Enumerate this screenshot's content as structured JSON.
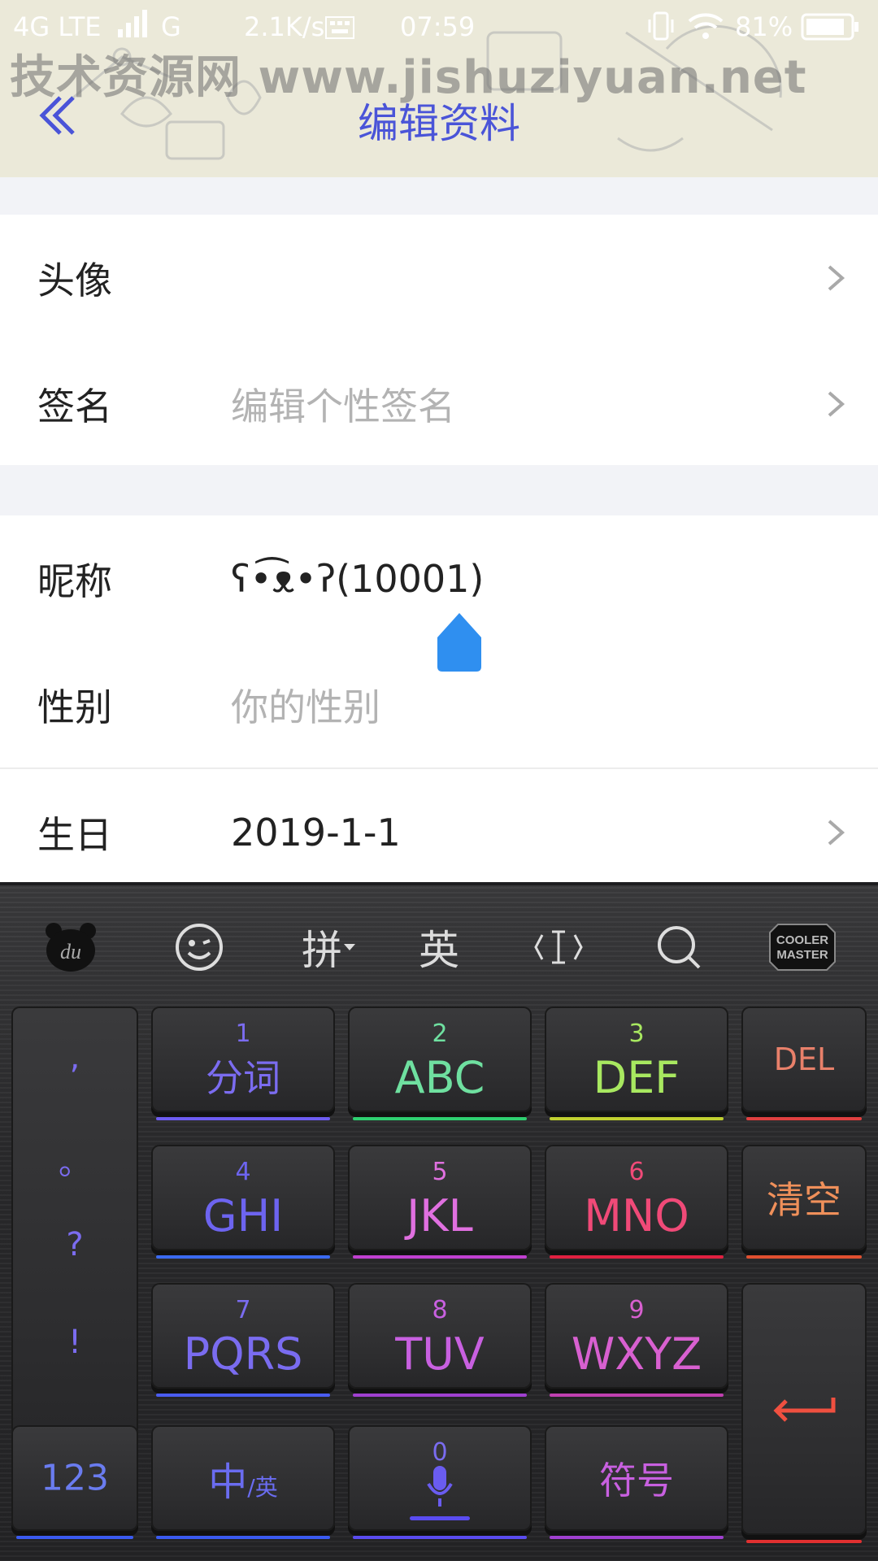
{
  "status_bar": {
    "network": "4G LTE",
    "network2": "G",
    "speed": "2.1K/s",
    "time": "07:59",
    "battery": "81%"
  },
  "watermark": "技术资源网  www.jishuziyuan.net",
  "header": {
    "title": "编辑资料",
    "back_icon": "double-chevron-left-icon"
  },
  "profile": {
    "avatar_label": "头像",
    "signature_label": "签名",
    "signature_placeholder": "编辑个性签名",
    "nickname_label": "昵称",
    "nickname_value": "ʕ•͡ᴥ•ʔ(10001)",
    "gender_label": "性别",
    "gender_placeholder": "你的性别",
    "birthday_label": "生日",
    "birthday_value": "2019-1-1"
  },
  "keyboard": {
    "toolbar": {
      "pinyin": "拼",
      "english": "英",
      "brand_line1": "COOLER",
      "brand_line2": "MASTER",
      "du": "du"
    },
    "punctuation": [
      ",",
      "。",
      "?",
      "!"
    ],
    "keys": [
      {
        "num": "1",
        "label": "分词",
        "color": "#7b6cf0"
      },
      {
        "num": "2",
        "label": "ABC",
        "color": "#6fe0a0"
      },
      {
        "num": "3",
        "label": "DEF",
        "color": "#a8e860"
      },
      {
        "num": "4",
        "label": "GHI",
        "color": "#6d64f0"
      },
      {
        "num": "5",
        "label": "JKL",
        "color": "#e070e0"
      },
      {
        "num": "6",
        "label": "MNO",
        "color": "#f04a78"
      },
      {
        "num": "7",
        "label": "PQRS",
        "color": "#6d64f0"
      },
      {
        "num": "8",
        "label": "TUV",
        "color": "#c860e0"
      },
      {
        "num": "9",
        "label": "WXYZ",
        "color": "#d860d0"
      }
    ],
    "del": "DEL",
    "clear": "清空",
    "num_mode": "123",
    "zh": "中",
    "en_small": "/英",
    "space_num": "0",
    "symbols": "符号"
  }
}
